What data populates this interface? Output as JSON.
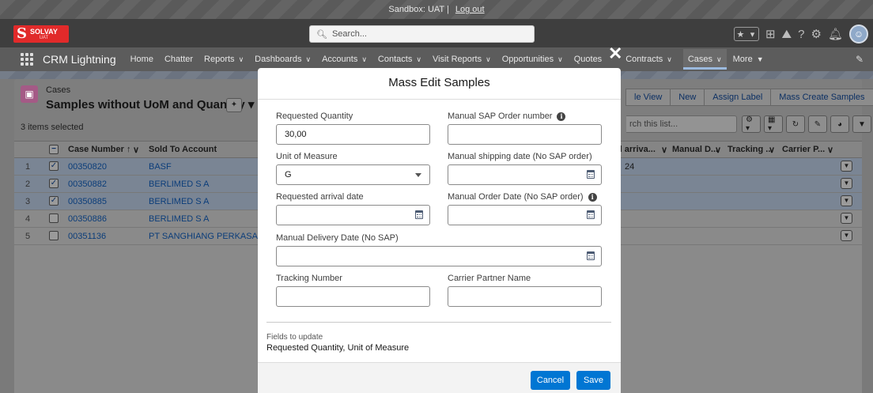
{
  "sandbox": {
    "label": "Sandbox: UAT |",
    "logout": "Log out"
  },
  "header": {
    "logo": {
      "brand": "SOLVAY",
      "sub": "UAT"
    },
    "search_placeholder": "Search..."
  },
  "nav": {
    "app_name": "CRM Lightning",
    "items": [
      "Home",
      "Chatter",
      "Reports",
      "Dashboards",
      "Accounts",
      "Contacts",
      "Visit Reports",
      "Opportunities",
      "Quotes",
      "Contracts",
      "Cases",
      "More"
    ]
  },
  "list": {
    "object_label": "Cases",
    "title": "Samples without UoM and Quantity",
    "items_selected": "3 items selected",
    "buttons": [
      "le View",
      "New",
      "Assign Label",
      "Mass Create Samples"
    ],
    "search_placeholder": "rch this list...",
    "columns": [
      "Case Number ↑",
      "Sold To Account",
      "d arriva...",
      "Manual D...",
      "Tracking ...",
      "Carrier P..."
    ],
    "rows": [
      {
        "num": "1",
        "case": "00350820",
        "account": "BASF",
        "selected": true,
        "extra": "24"
      },
      {
        "num": "2",
        "case": "00350882",
        "account": "BERLIMED S A",
        "selected": true,
        "extra": ""
      },
      {
        "num": "3",
        "case": "00350885",
        "account": "BERLIMED S A",
        "selected": true,
        "extra": ""
      },
      {
        "num": "4",
        "case": "00350886",
        "account": "BERLIMED S A",
        "selected": false,
        "extra": ""
      },
      {
        "num": "5",
        "case": "00351136",
        "account": "PT SANGHIANG PERKASA (KALBE",
        "selected": false,
        "extra": ""
      }
    ]
  },
  "modal": {
    "title": "Mass Edit Samples",
    "fields": {
      "requested_quantity": {
        "label": "Requested Quantity",
        "value": "30,00"
      },
      "manual_sap_order": {
        "label": "Manual SAP Order number",
        "value": ""
      },
      "unit_of_measure": {
        "label": "Unit of Measure",
        "value": "G"
      },
      "manual_shipping_date": {
        "label": "Manual shipping date (No SAP order)",
        "value": ""
      },
      "requested_arrival_date": {
        "label": "Requested arrival date",
        "value": ""
      },
      "manual_order_date": {
        "label": "Manual Order Date (No SAP order)",
        "value": ""
      },
      "manual_delivery_date": {
        "label": "Manual Delivery Date (No SAP)",
        "value": ""
      },
      "tracking_number": {
        "label": "Tracking Number",
        "value": ""
      },
      "carrier_partner_name": {
        "label": "Carrier Partner Name",
        "value": ""
      }
    },
    "fields_to_update_label": "Fields to update",
    "fields_to_update_value": "Requested Quantity, Unit of Measure",
    "cancel_label": "Cancel",
    "save_label": "Save"
  },
  "colors": {
    "brand_button": "#0176d3",
    "logo_red": "#e12a2a"
  }
}
